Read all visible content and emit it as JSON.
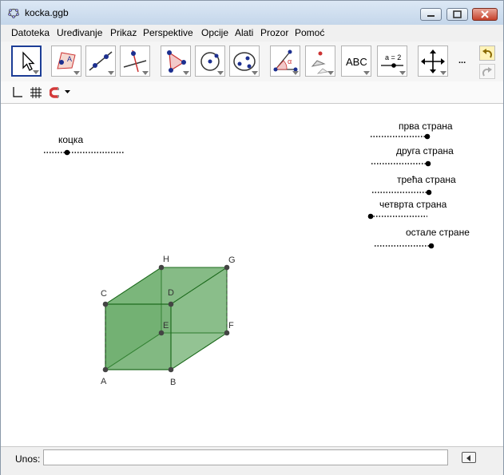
{
  "window": {
    "title": "kocka.ggb"
  },
  "menu": [
    "Datoteka",
    "Uređivanje",
    "Prikaz",
    "Perspektive",
    "Opcije",
    "Alati",
    "Prozor",
    "Pomoć"
  ],
  "toolbar": {
    "abc_label": "ABC",
    "slider_label": "a = 2",
    "more_label": "..."
  },
  "sliders": {
    "kocka": "коцка",
    "prva": "прва страна",
    "druga": "друга страна",
    "treca": "трећа страна",
    "cetvrta": "четврта страна",
    "ostale": "остале стране"
  },
  "points": [
    "A",
    "B",
    "C",
    "D",
    "E",
    "F",
    "G",
    "H"
  ],
  "input": {
    "label": "Unos:",
    "value": ""
  },
  "colors": {
    "face": "#4a9a4a",
    "edge": "#1e6b1e",
    "accent": "#1c3d96"
  }
}
